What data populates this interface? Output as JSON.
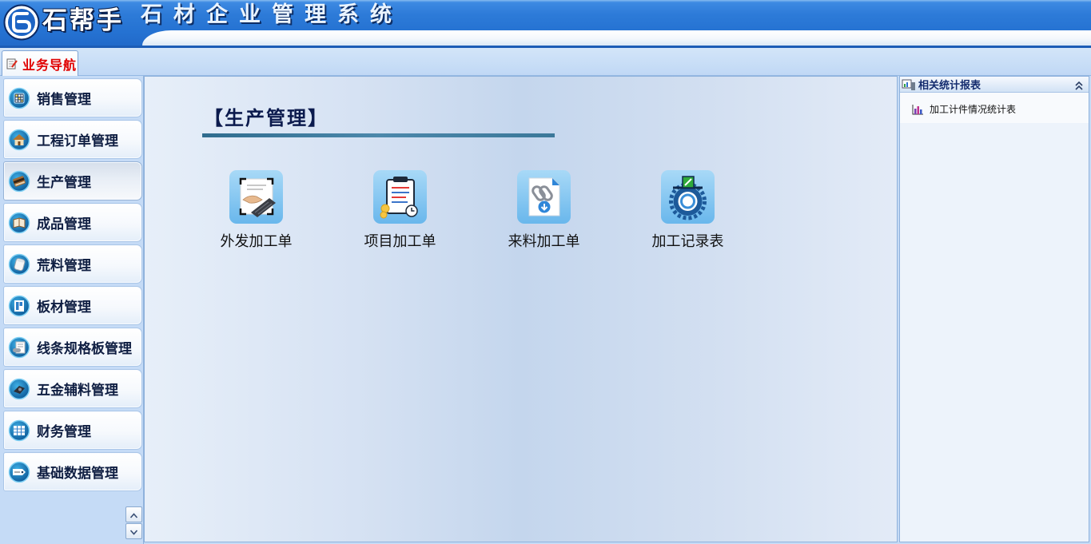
{
  "app": {
    "logo_text": "石帮手",
    "title": "石材企业管理系统"
  },
  "tabs": [
    {
      "label": "业务导航",
      "icon": "notepad-icon",
      "active": true
    }
  ],
  "sidebar": {
    "items": [
      {
        "label": "销售管理",
        "icon": "sales-icon"
      },
      {
        "label": "工程订单管理",
        "icon": "project-order-icon"
      },
      {
        "label": "生产管理",
        "icon": "production-icon",
        "selected": true
      },
      {
        "label": "成品管理",
        "icon": "finished-goods-icon"
      },
      {
        "label": "荒料管理",
        "icon": "raw-block-icon"
      },
      {
        "label": "板材管理",
        "icon": "slab-icon"
      },
      {
        "label": "线条规格板管理",
        "icon": "moulding-icon"
      },
      {
        "label": "五金辅料管理",
        "icon": "hardware-icon"
      },
      {
        "label": "财务管理",
        "icon": "finance-icon"
      },
      {
        "label": "基础数据管理",
        "icon": "basic-data-icon"
      }
    ],
    "scroll_up_icon": "chevron-up-icon",
    "scroll_down_icon": "chevron-down-icon"
  },
  "main": {
    "title": "【生产管理】",
    "shortcuts": [
      {
        "label": "外发加工单",
        "icon": "outsource-processing-icon"
      },
      {
        "label": "项目加工单",
        "icon": "project-processing-icon"
      },
      {
        "label": "来料加工单",
        "icon": "incoming-processing-icon"
      },
      {
        "label": "加工记录表",
        "icon": "processing-record-icon"
      }
    ]
  },
  "right_panel": {
    "title": "相关统计报表",
    "icon": "report-group-icon",
    "collapse_icon": "double-chevron-up-icon",
    "reports": [
      {
        "label": "加工计件情况统计表",
        "icon": "bar-chart-icon"
      }
    ]
  },
  "colors": {
    "header_blue": "#2572d2",
    "tab_label_red": "#e00000",
    "title_navy": "#0b1a4d",
    "panel_light_blue": "#c5dbf6",
    "icon_tile_blue": "#8ccbf2"
  }
}
